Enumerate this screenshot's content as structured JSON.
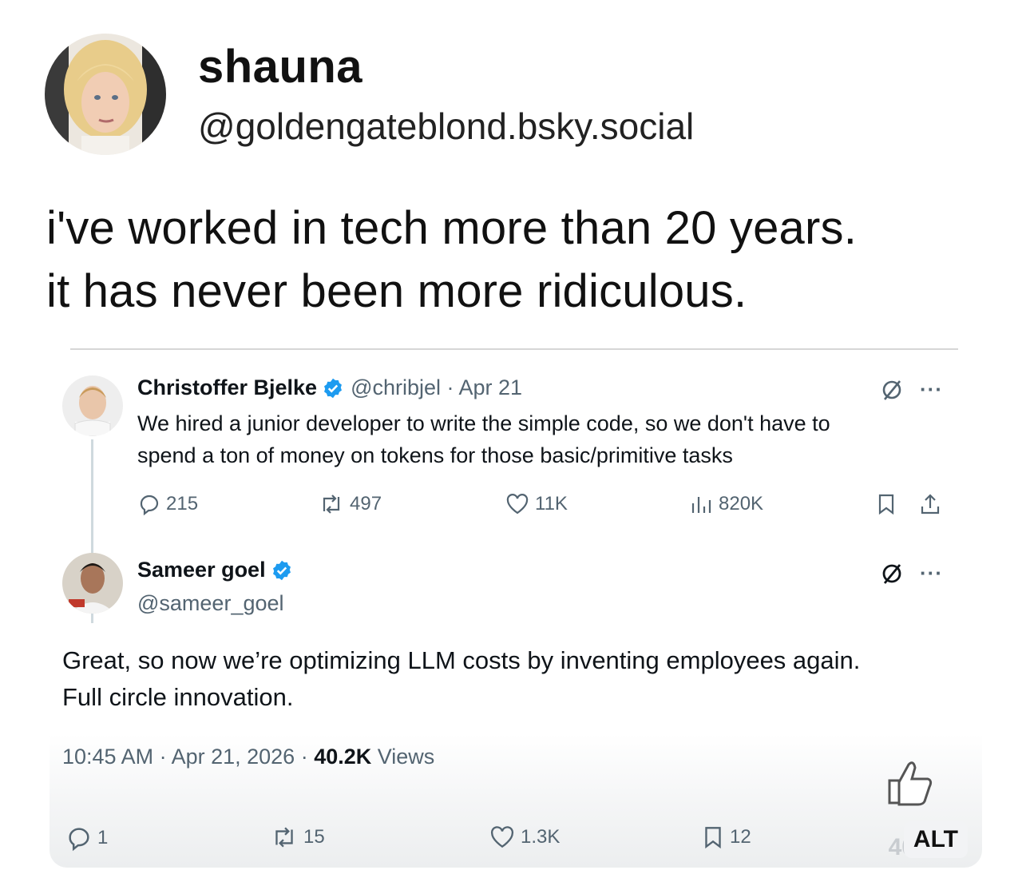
{
  "post": {
    "author": {
      "name": "shauna",
      "handle": "@goldengateblond.bsky.social"
    },
    "text_lines": [
      "i've worked in tech more than 20 years.",
      "it has never been more ridiculous."
    ]
  },
  "embed": {
    "quoted_tweet": {
      "name": "Christoffer Bjelke",
      "handle": "@chribjel",
      "meta": "@chribjel · Apr 21",
      "text_lines": [
        "We hired a junior developer to write the simple code, so we don't have to",
        "spend a ton of money on tokens for those basic/primitive tasks"
      ],
      "stats": {
        "replies": "215",
        "reposts": "497",
        "likes": "11K",
        "views": "820K"
      }
    },
    "reply_tweet": {
      "name": "Sameer goel",
      "handle": "@sameer_goel",
      "text_lines": [
        "Great, so now we’re optimizing LLM costs by inventing employees again.",
        "Full circle innovation."
      ],
      "time": "10:45 AM · Apr 21, 2026 · ",
      "views_count": "40.2K",
      "views_label": " Views",
      "stats": {
        "replies": "1",
        "reposts": "15",
        "likes": "1.3K",
        "bookmarks": "12"
      }
    },
    "alt_label": "ALT",
    "faint_count": "40"
  },
  "icons": {
    "reply": "comment-bubble-icon",
    "repost": "repost-arrows-icon",
    "like": "heart-icon",
    "views": "bar-chart-icon",
    "bookmark": "bookmark-icon",
    "share": "share-upload-icon",
    "grok": "slashed-circle-icon",
    "more": "more-dots-icon",
    "verified": "verified-badge-icon"
  },
  "colors": {
    "verified": "#1d9bf0",
    "muted": "#536471",
    "text": "#0f1419"
  }
}
